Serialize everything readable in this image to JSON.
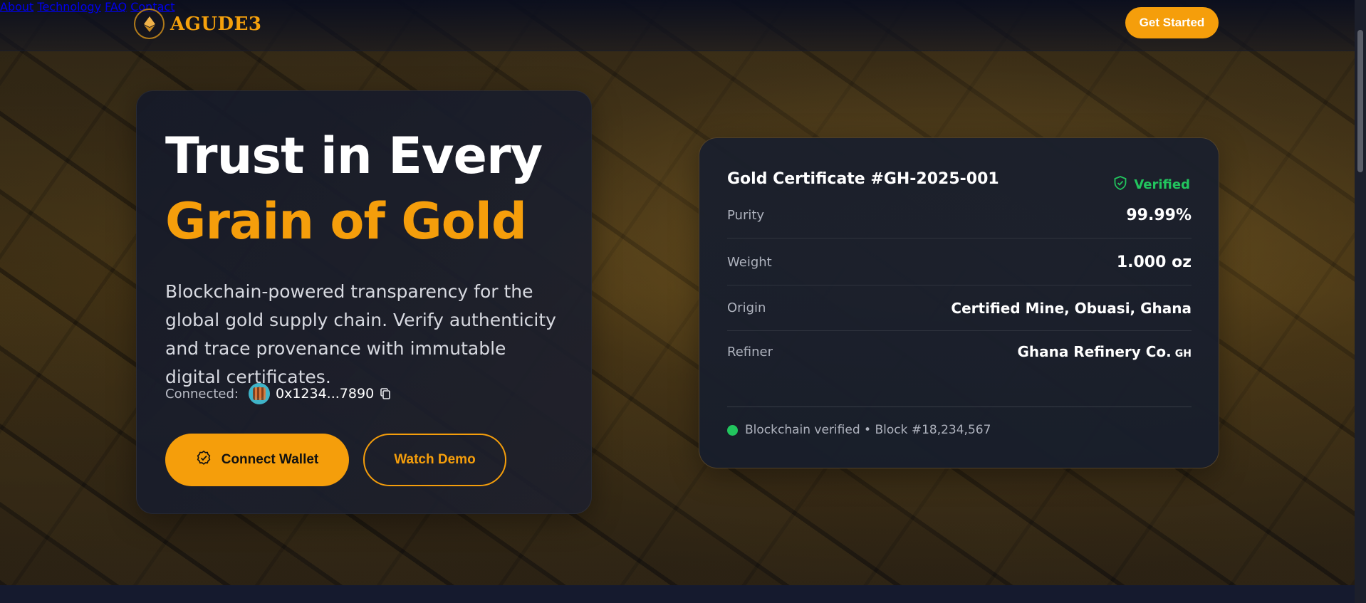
{
  "brand": {
    "name": "AGUDE3",
    "logo_icon": "ethereum-diamond-icon",
    "accent": "#f59e0b"
  },
  "nav": {
    "items": [
      {
        "label": "About"
      },
      {
        "label": "Technology"
      },
      {
        "label": "FAQ"
      },
      {
        "label": "Contact"
      }
    ],
    "cta_label": "Get Started"
  },
  "hero": {
    "headline_line1": "Trust in Every",
    "headline_line2": "Grain of Gold",
    "subtitle": "Blockchain-powered transparency for the global gold supply chain. Verify authenticity and trace provenance with immutable digital certificates.",
    "connected_label": "Connected:",
    "wallet_address": "0x1234...7890",
    "connect_button_label": "Connect Wallet",
    "demo_button_label": "Watch Demo"
  },
  "certificate": {
    "title": "Gold Certificate #GH-2025-001",
    "status": "Verified",
    "status_color": "#22c55e",
    "rows": [
      {
        "key": "Purity",
        "value": "99.99%"
      },
      {
        "key": "Weight",
        "value": "1.000 oz"
      },
      {
        "key": "Origin",
        "value": "Certified Mine, Obuasi, Ghana"
      },
      {
        "key": "Refiner",
        "value": "Ghana Refinery Co.",
        "flag": "GH"
      }
    ],
    "footer_text": "Blockchain verified • Block #18,234,567"
  }
}
